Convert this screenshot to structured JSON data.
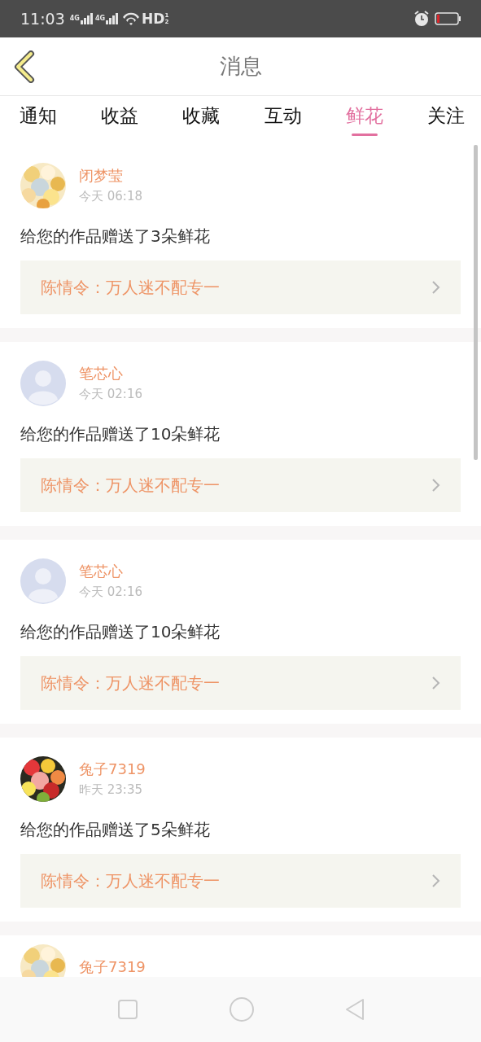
{
  "status_bar": {
    "time": "11:03",
    "signals": [
      "4G",
      "4G"
    ],
    "hd": "HD",
    "hd_slots": [
      "1",
      "2"
    ]
  },
  "header": {
    "title": "消息"
  },
  "tabs": [
    {
      "label": "通知",
      "selected": false
    },
    {
      "label": "收益",
      "selected": false
    },
    {
      "label": "收藏",
      "selected": false
    },
    {
      "label": "互动",
      "selected": false
    },
    {
      "label": "鲜花",
      "selected": true
    },
    {
      "label": "关注",
      "selected": false
    }
  ],
  "messages": [
    {
      "user": "闭梦莹",
      "time": "今天 06:18",
      "text": "给您的作品赠送了3朵鲜花",
      "work": "陈情令：万人迷不配专一"
    },
    {
      "user": "笔芯心",
      "avatar": {
        "kind": "default"
      },
      "time": "今天 02:16",
      "text": "给您的作品赠送了10朵鲜花",
      "work": "陈情令：万人迷不配专一"
    },
    {
      "user": "笔芯心",
      "avatar": {
        "kind": "default"
      },
      "time": "今天 02:16",
      "text": "给您的作品赠送了10朵鲜花",
      "work": "陈情令：万人迷不配专一"
    },
    {
      "user": "兔子7319",
      "time": "昨天 23:35",
      "text": "给您的作品赠送了5朵鲜花",
      "work": "陈情令：万人迷不配专一"
    },
    {
      "user": "兔子7319"
    }
  ]
}
